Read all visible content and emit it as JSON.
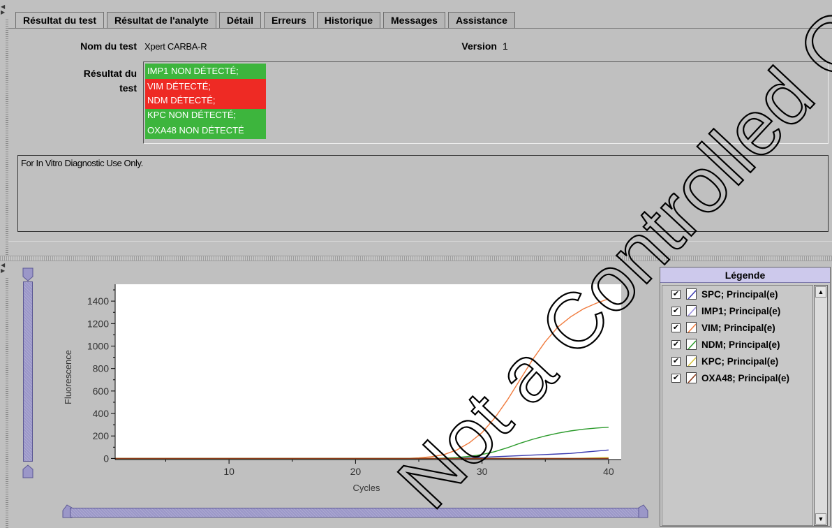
{
  "tabs": [
    "Résultat du test",
    "Résultat de l'analyte",
    "Détail",
    "Erreurs",
    "Historique",
    "Messages",
    "Assistance"
  ],
  "test_name_label": "Nom du test",
  "test_name_value": "Xpert CARBA-R",
  "version_label": "Version",
  "version_value": "1",
  "result_label_line1": "Résultat du",
  "result_label_line2": "test",
  "results": [
    {
      "text": "IMP1 NON DÉTECTÉ;",
      "color": "#3db53d"
    },
    {
      "text": "VIM DÉTECTÉ;",
      "color": "#ee2a24"
    },
    {
      "text": "NDM DÉTECTÉ;",
      "color": "#ee2a24"
    },
    {
      "text": "KPC NON DÉTECTÉ;",
      "color": "#3db53d"
    },
    {
      "text": "OXA48 NON DÉTECTÉ",
      "color": "#3db53d"
    }
  ],
  "disclaimer": "For In Vitro Diagnostic Use Only.",
  "legend": {
    "title": "Légende",
    "items": [
      {
        "label": "SPC; Principal(e)",
        "color": "#3a3ab0",
        "checked": true
      },
      {
        "label": "IMP1; Principal(e)",
        "color": "#9a8ee0",
        "checked": true
      },
      {
        "label": "VIM; Principal(e)",
        "color": "#f07a3c",
        "checked": true
      },
      {
        "label": "NDM; Principal(e)",
        "color": "#2a9a2a",
        "checked": true
      },
      {
        "label": "KPC; Principal(e)",
        "color": "#d7c33a",
        "checked": true
      },
      {
        "label": "OXA48; Principal(e)",
        "color": "#8a3a1a",
        "checked": true
      }
    ]
  },
  "watermark": "Not a Controlled Copy",
  "chart_data": {
    "type": "line",
    "xlabel": "Cycles",
    "ylabel": "Fluorescence",
    "xlim": [
      1,
      41
    ],
    "ylim": [
      -10,
      1550
    ],
    "xticks": [
      10,
      20,
      30,
      40
    ],
    "yticks": [
      0,
      200,
      400,
      600,
      800,
      1000,
      1200,
      1400
    ],
    "x": [
      1,
      5,
      10,
      15,
      20,
      24,
      25,
      26,
      27,
      28,
      29,
      30,
      31,
      32,
      33,
      34,
      35,
      36,
      37,
      38,
      39,
      40
    ],
    "series": [
      {
        "name": "SPC; Principal(e)",
        "color": "#3a3ab0",
        "values": [
          0,
          0,
          0,
          0,
          0,
          0,
          0,
          0,
          0,
          2,
          5,
          10,
          15,
          20,
          25,
          30,
          35,
          40,
          45,
          55,
          65,
          75
        ]
      },
      {
        "name": "IMP1; Principal(e)",
        "color": "#9a8ee0",
        "values": [
          0,
          0,
          0,
          0,
          0,
          0,
          0,
          0,
          0,
          0,
          0,
          0,
          0,
          0,
          0,
          0,
          0,
          0,
          0,
          0,
          0,
          0
        ]
      },
      {
        "name": "VIM; Principal(e)",
        "color": "#f07a3c",
        "values": [
          0,
          0,
          0,
          0,
          0,
          0,
          5,
          15,
          35,
          75,
          140,
          230,
          360,
          520,
          700,
          880,
          1040,
          1170,
          1260,
          1330,
          1380,
          1420
        ]
      },
      {
        "name": "NDM; Principal(e)",
        "color": "#2a9a2a",
        "values": [
          0,
          0,
          0,
          0,
          0,
          0,
          0,
          0,
          3,
          8,
          18,
          35,
          60,
          95,
          135,
          170,
          200,
          225,
          245,
          260,
          270,
          278
        ]
      },
      {
        "name": "KPC; Principal(e)",
        "color": "#d7c33a",
        "values": [
          0,
          0,
          0,
          0,
          0,
          0,
          0,
          0,
          0,
          0,
          0,
          0,
          0,
          0,
          0,
          0,
          0,
          0,
          0,
          2,
          5,
          8
        ]
      },
      {
        "name": "OXA48; Principal(e)",
        "color": "#8a3a1a",
        "values": [
          0,
          0,
          0,
          0,
          0,
          0,
          0,
          0,
          0,
          0,
          0,
          0,
          0,
          0,
          0,
          0,
          0,
          0,
          0,
          0,
          0,
          0
        ]
      }
    ]
  }
}
